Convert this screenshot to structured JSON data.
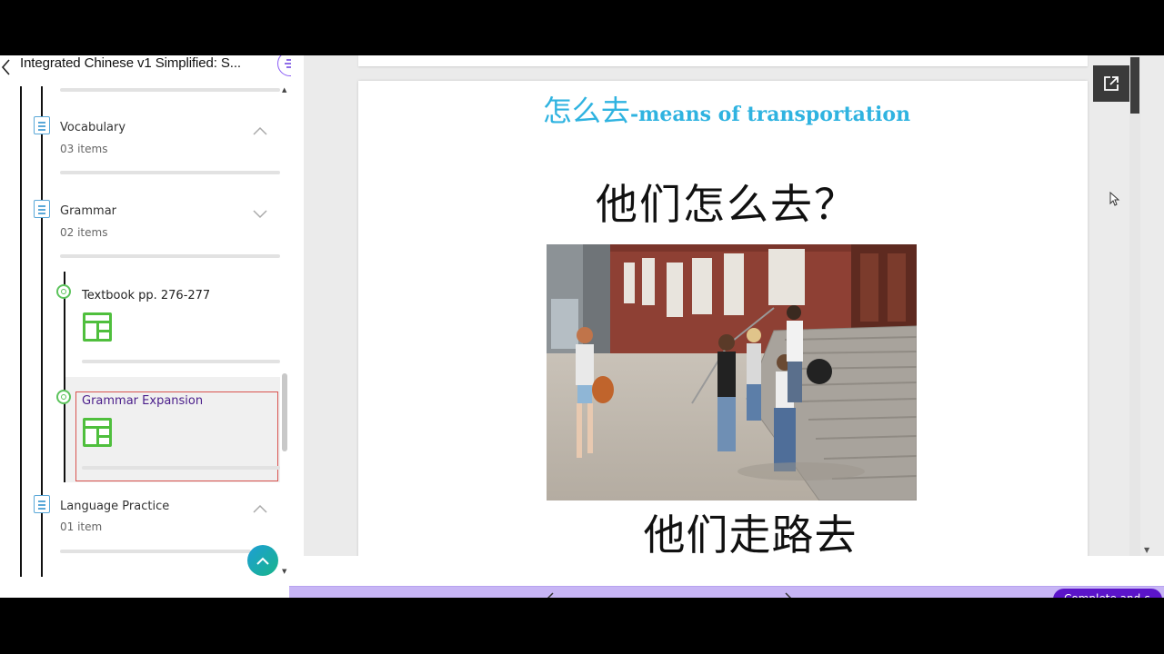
{
  "header": {
    "course_title": "Integrated Chinese v1 Simplified: S..."
  },
  "sidebar": {
    "sections": [
      {
        "title": "Vocabulary",
        "count": "03 items",
        "expanded": false
      },
      {
        "title": "Grammar",
        "count": "02 items",
        "expanded": true
      },
      {
        "title": "Language Practice",
        "count": "01 item",
        "expanded": false
      }
    ],
    "grammar_items": [
      {
        "title": "Textbook pp. 276-277",
        "active": false
      },
      {
        "title": "Grammar Expansion",
        "active": true
      }
    ]
  },
  "slide": {
    "title_zh": "怎么去",
    "title_en": "-means of transportation",
    "question": "他们怎么去？",
    "answer": "他们走路去"
  },
  "bottom_bar": {
    "complete_label": "Complete and c"
  },
  "colors": {
    "accent_purple": "#5b14c9",
    "bottom_bar_bg": "#c7b5f5",
    "slide_title": "#2fb3e0",
    "item_icon_green": "#5cc35c",
    "section_icon_blue": "#5aa8d8",
    "active_border": "#d9534f"
  },
  "icons": [
    "back-arrow-icon",
    "outline-menu-icon",
    "document-icon",
    "chevron-up-icon",
    "chevron-down-icon",
    "layout-grid-icon",
    "open-external-icon",
    "mouse-cursor-icon",
    "arrow-up-icon"
  ]
}
